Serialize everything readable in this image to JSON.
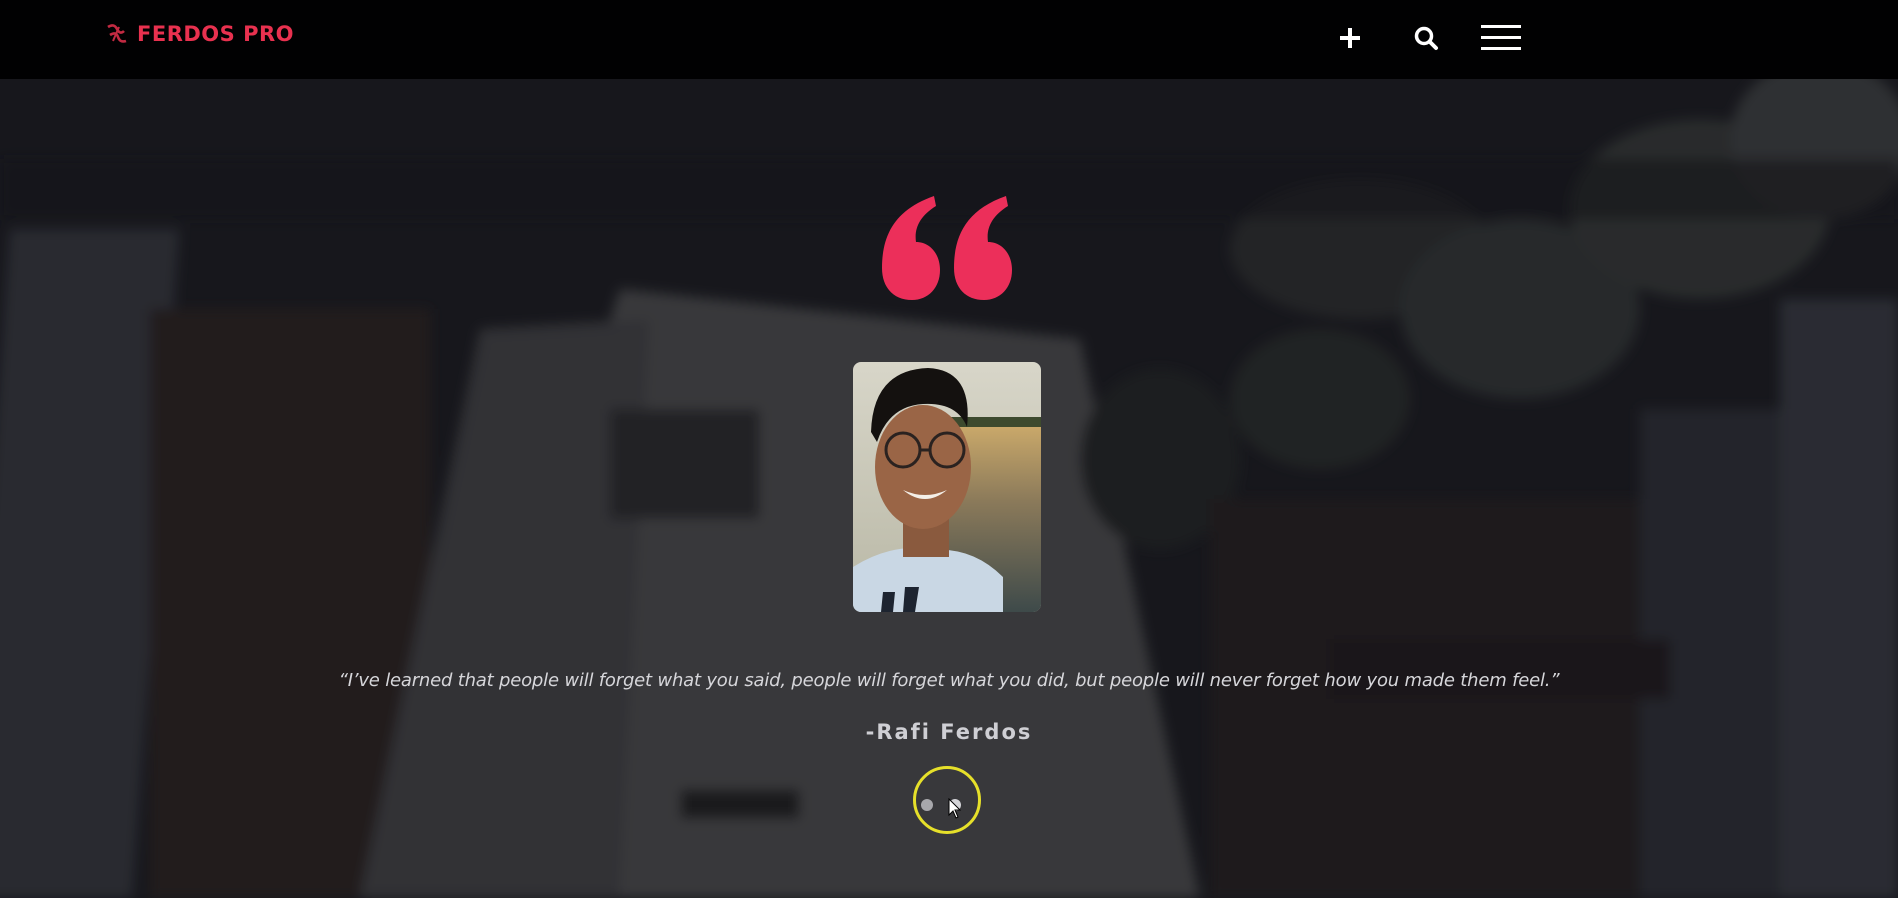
{
  "header": {
    "brand_name": "FERDOS PRO",
    "brand_color": "#e8314f",
    "icons": [
      "logo-mark-icon",
      "plus-icon",
      "search-icon",
      "hamburger-menu-icon"
    ]
  },
  "testimonial": {
    "quote_icon": "quote-open-icon",
    "quote_color": "#ec2f5a",
    "quote": "“I’ve learned that people will forget what you said, people will forget what you did, but people will never forget how you made them feel.”",
    "author": "-Rafi Ferdos",
    "slides_total": 2,
    "active_slide": 2
  }
}
